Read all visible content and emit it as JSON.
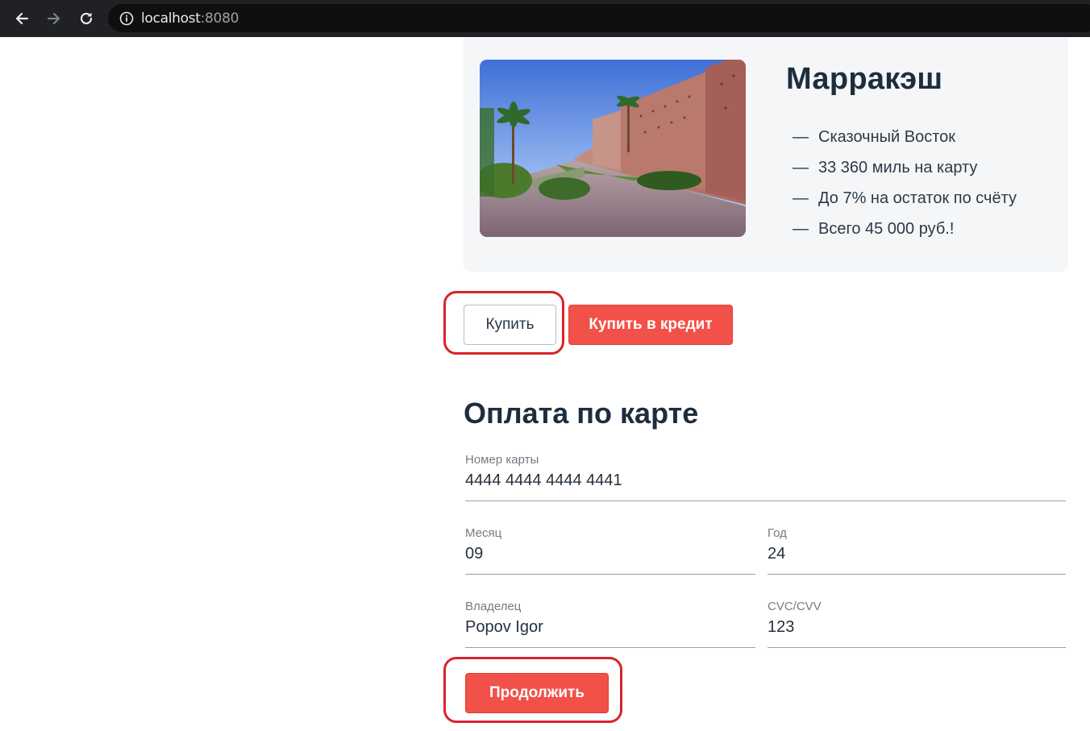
{
  "browser": {
    "url_host": "localhost",
    "url_port": ":8080",
    "icons": [
      "back-arrow-icon",
      "forward-arrow-icon",
      "reload-icon",
      "info-icon"
    ]
  },
  "card": {
    "title": "Марракэш",
    "image": "marrakesh-city-wall-photo",
    "features": [
      "Сказочный Восток",
      "33 360 миль на карту",
      "До 7% на остаток по счёту",
      "Всего 45 000 руб.!"
    ],
    "dash": "—"
  },
  "actions": {
    "buy_label": "Купить",
    "credit_label": "Купить в кредит"
  },
  "payment_form": {
    "title": "Оплата по карте",
    "card_number": {
      "label": "Номер карты",
      "value": "4444 4444 4444 4441"
    },
    "month": {
      "label": "Месяц",
      "value": "09"
    },
    "year": {
      "label": "Год",
      "value": "24"
    },
    "owner": {
      "label": "Владелец",
      "value": "Popov Igor"
    },
    "cvc": {
      "label": "CVC/CVV",
      "value": "123"
    },
    "continue_label": "Продолжить"
  },
  "colors": {
    "accent": "#f25149",
    "browser_bar": "#202124",
    "card_bg": "#f4f6f8",
    "highlight": "#d8232a"
  }
}
